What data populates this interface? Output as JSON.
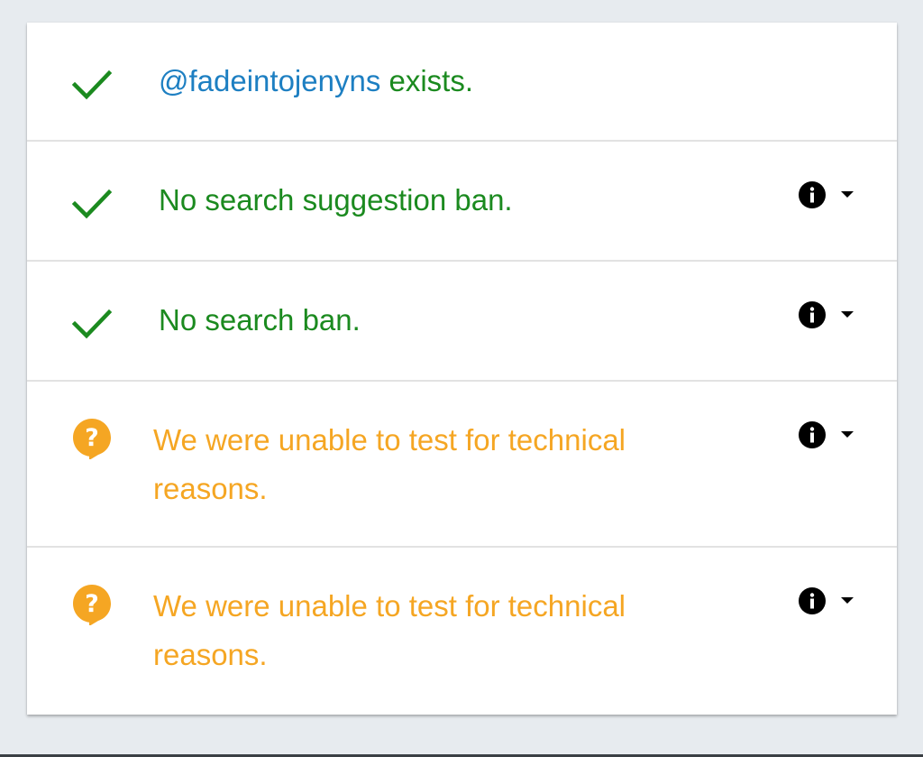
{
  "colors": {
    "success": "#1b8a1f",
    "link": "#1d7fc2",
    "warning": "#f5a623"
  },
  "results": [
    {
      "status": "success",
      "icon": "checkmark-icon",
      "handle": "@fadeintojenyns",
      "text": " exists."
    },
    {
      "status": "success",
      "icon": "checkmark-icon",
      "text": "No search suggestion ban.",
      "has_details": true
    },
    {
      "status": "success",
      "icon": "checkmark-icon",
      "text": "No search ban.",
      "has_details": true
    },
    {
      "status": "unknown",
      "icon": "question-icon",
      "text": "We were unable to test for technical reasons.",
      "has_details": true
    },
    {
      "status": "unknown",
      "icon": "question-icon",
      "text": "We were unable to test for technical reasons.",
      "has_details": true
    }
  ]
}
